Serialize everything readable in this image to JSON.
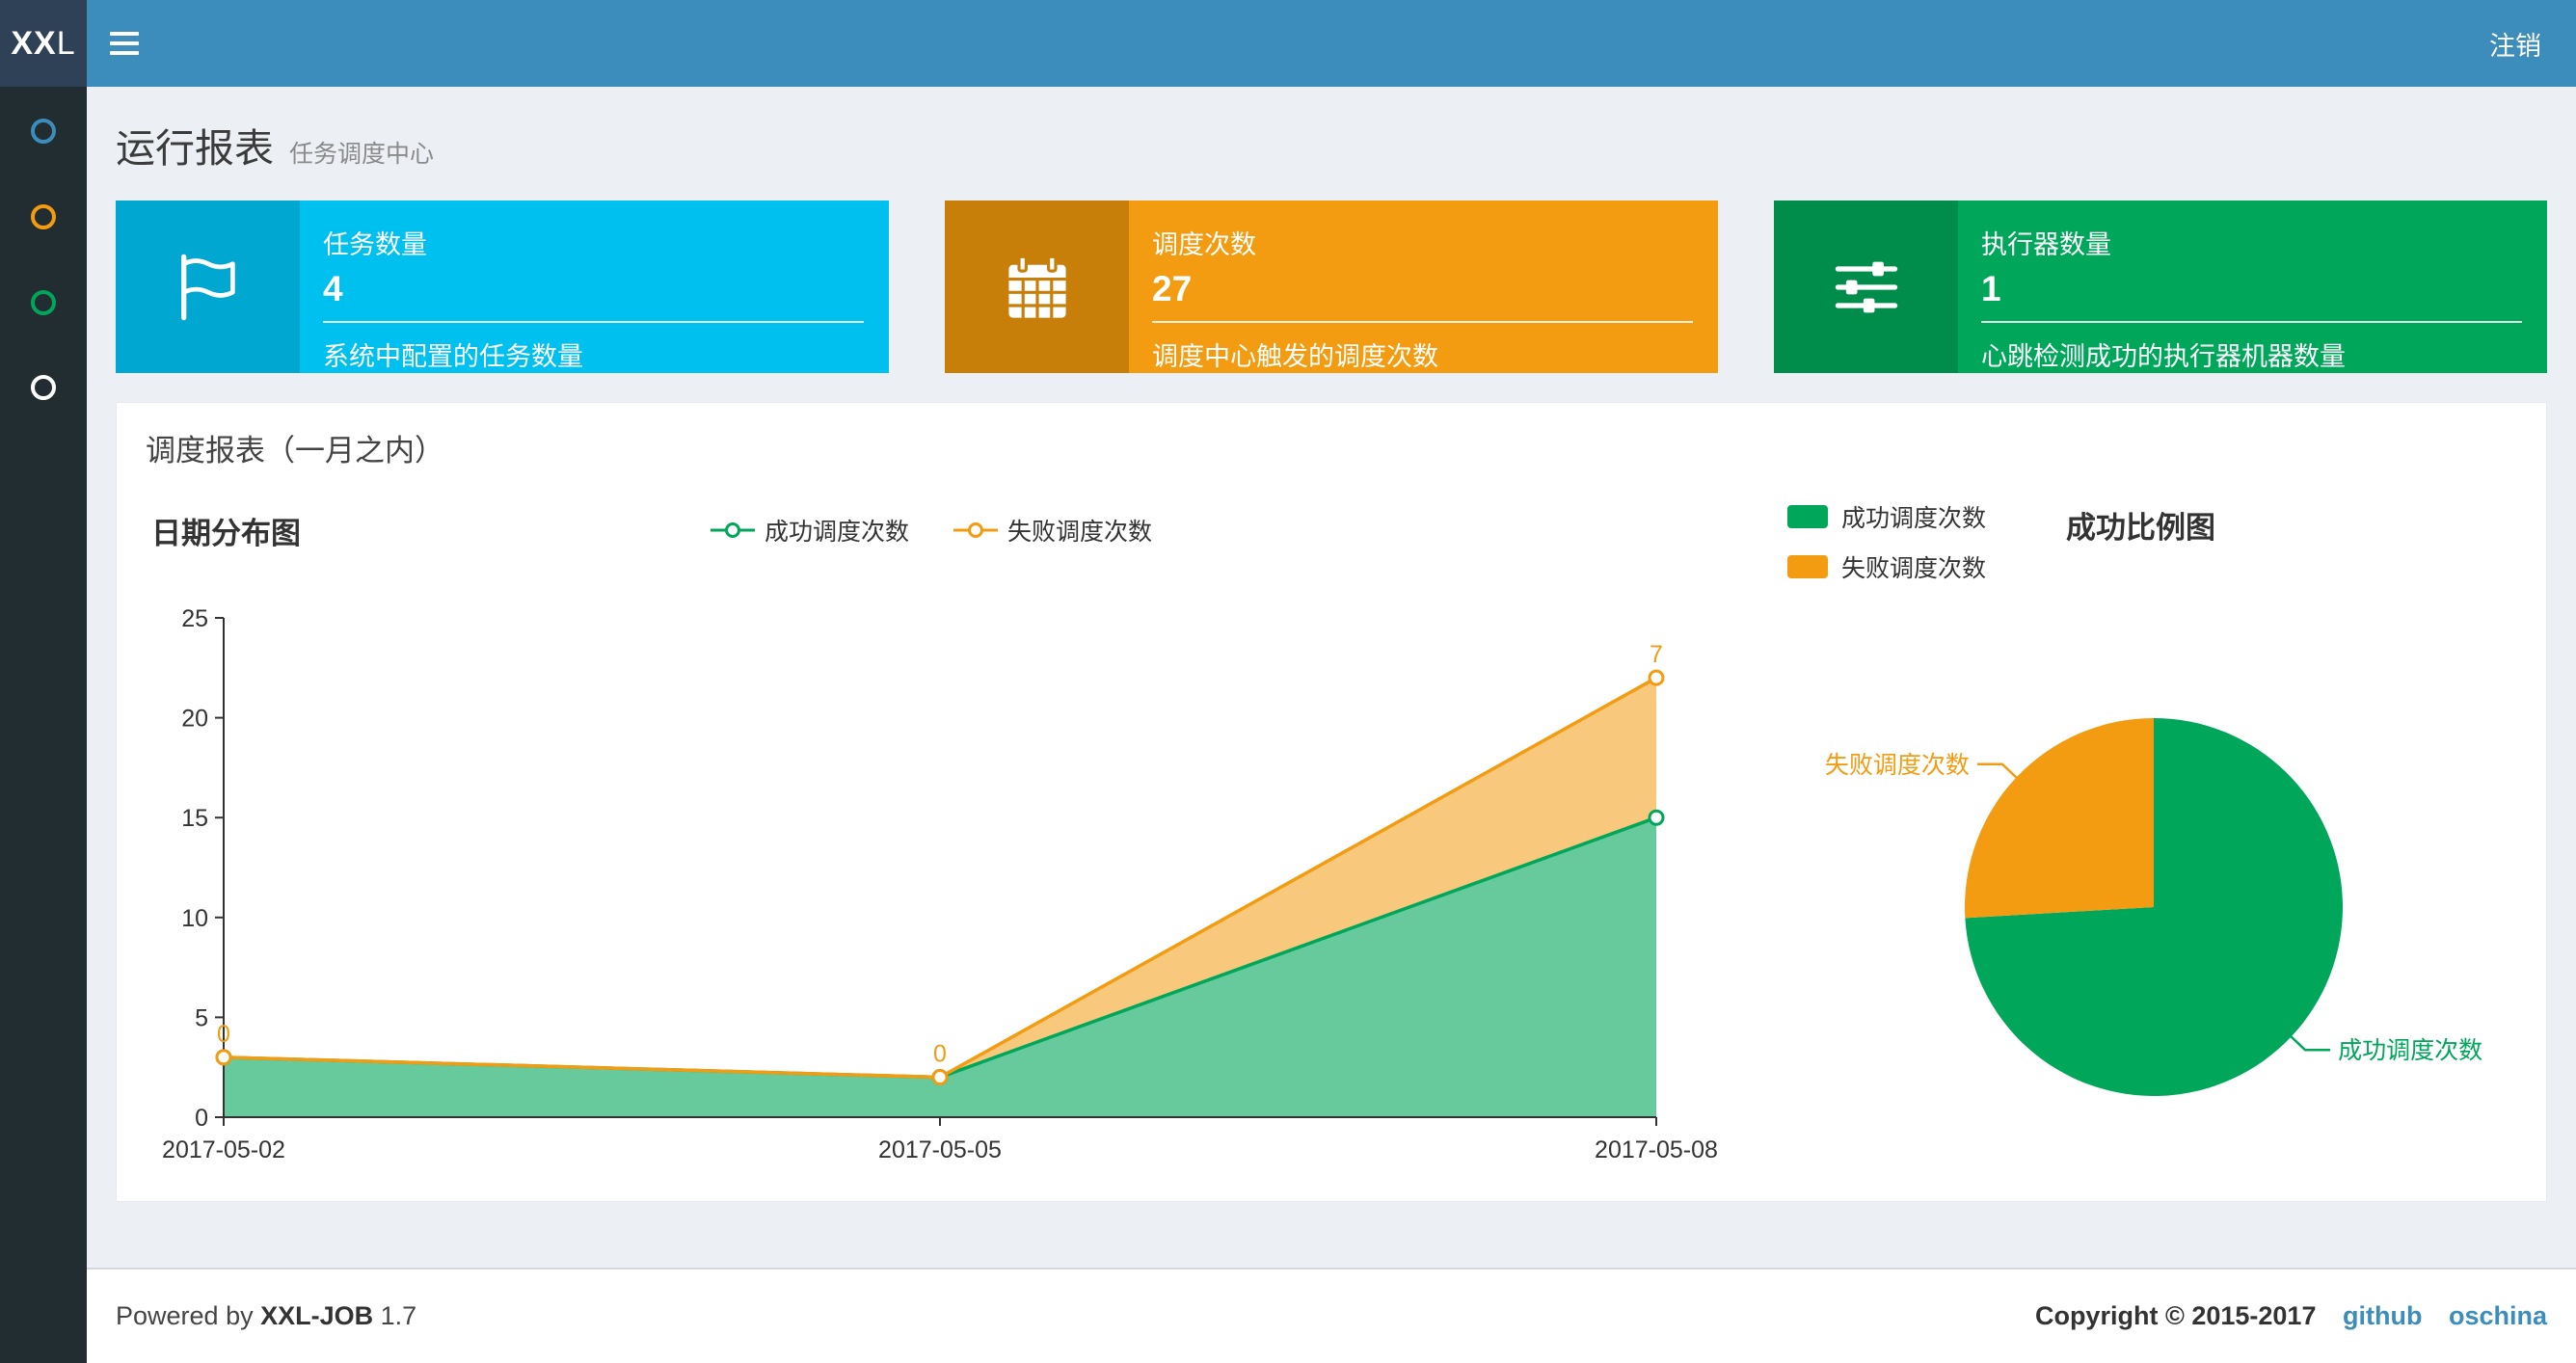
{
  "navbar": {
    "logo_bold": "XX",
    "logo_light": "L",
    "logout": "注销"
  },
  "sidebar": {
    "items": [
      {
        "color": "#3c8dbc"
      },
      {
        "color": "#f39c12"
      },
      {
        "color": "#00a65a"
      },
      {
        "color": "#ffffff"
      }
    ]
  },
  "header": {
    "title": "运行报表",
    "subtitle": "任务调度中心"
  },
  "info_boxes": [
    {
      "title": "任务数量",
      "value": "4",
      "desc": "系统中配置的任务数量",
      "bg": "#00c0ef",
      "icon_bg": "#00a7d0",
      "icon": "flag-icon"
    },
    {
      "title": "调度次数",
      "value": "27",
      "desc": "调度中心触发的调度次数",
      "bg": "#f39c12",
      "icon_bg": "#c87f0a",
      "icon": "calendar-icon"
    },
    {
      "title": "执行器数量",
      "value": "1",
      "desc": "心跳检测成功的执行器机器数量",
      "bg": "#00a65a",
      "icon_bg": "#008d4c",
      "icon": "sliders-icon"
    }
  ],
  "panel": {
    "title": "调度报表（一月之内）"
  },
  "chart_data": [
    {
      "type": "area",
      "title": "日期分布图",
      "x": [
        "2017-05-02",
        "2017-05-05",
        "2017-05-08"
      ],
      "stacked": true,
      "ylim": [
        0,
        25
      ],
      "yticks": [
        0,
        5,
        10,
        15,
        20,
        25
      ],
      "legend_position": "top-center",
      "grid": false,
      "series": [
        {
          "name": "成功调度次数",
          "color": "#00a65a",
          "values": [
            3,
            2,
            15
          ],
          "fill_opacity": 0.6,
          "show_labels": false
        },
        {
          "name": "失败调度次数",
          "color": "#f39c12",
          "values": [
            0,
            0,
            7
          ],
          "fill_opacity": 0.55,
          "show_labels": true
        }
      ]
    },
    {
      "type": "pie",
      "title": "成功比例图",
      "legend_position": "top-left",
      "slices": [
        {
          "name": "成功调度次数",
          "value": 20,
          "color": "#00a65a"
        },
        {
          "name": "失败调度次数",
          "value": 7,
          "color": "#f39c12"
        }
      ]
    }
  ],
  "footer": {
    "powered_prefix": "Powered by",
    "product": "XXL-JOB",
    "version": "1.7",
    "copyright": "Copyright © 2015-2017",
    "links": [
      {
        "label": "github"
      },
      {
        "label": "oschina"
      }
    ]
  }
}
